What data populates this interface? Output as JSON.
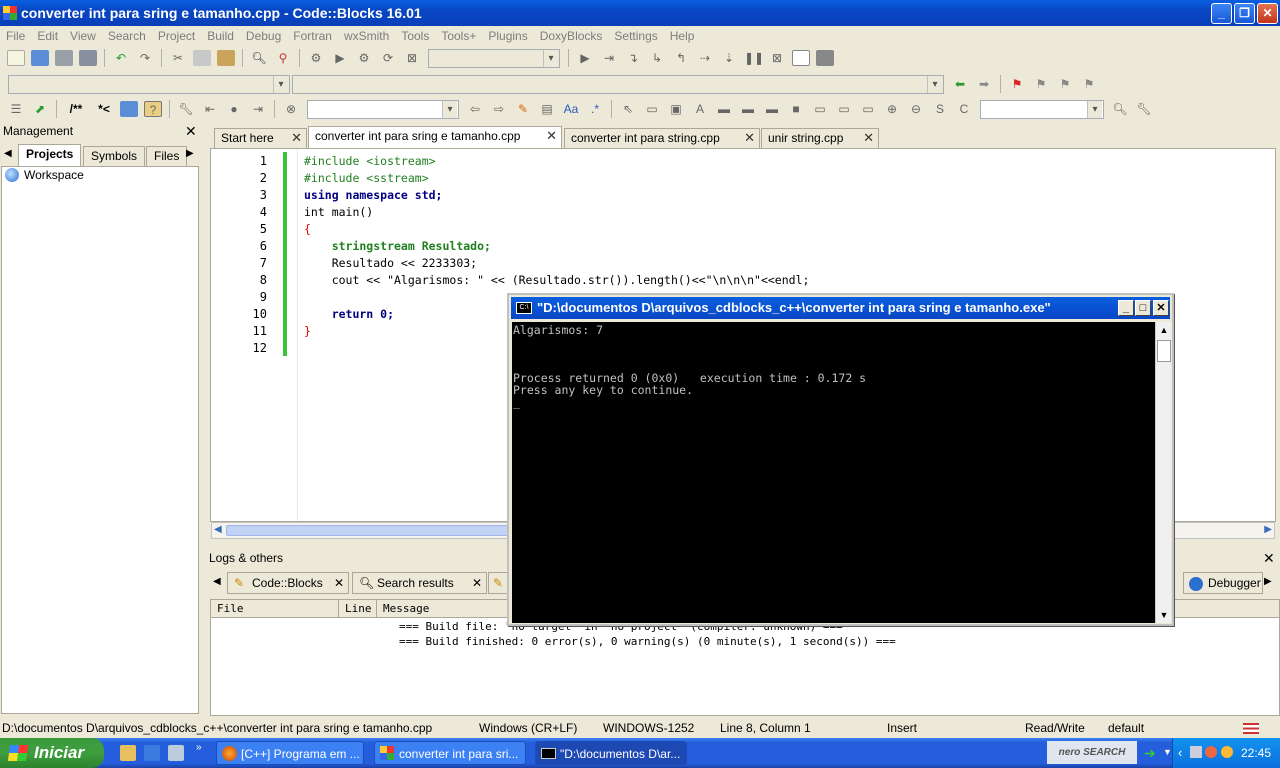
{
  "window": {
    "title": "converter int para sring e tamanho.cpp - Code::Blocks 16.01"
  },
  "menu": [
    "File",
    "Edit",
    "View",
    "Search",
    "Project",
    "Build",
    "Debug",
    "Fortran",
    "wxSmith",
    "Tools",
    "Tools+",
    "Plugins",
    "DoxyBlocks",
    "Settings",
    "Help"
  ],
  "management": {
    "title": "Management",
    "tabs": [
      "Projects",
      "Symbols",
      "Files"
    ],
    "tree_root": "Workspace"
  },
  "editor": {
    "tabs": [
      "Start here",
      "converter int para sring e tamanho.cpp",
      "converter int para string.cpp",
      "unir string.cpp"
    ],
    "active_tab": 1,
    "line_numbers": [
      "1",
      "2",
      "3",
      "4",
      "5",
      "6",
      "7",
      "8",
      "9",
      "10",
      "11",
      "12"
    ],
    "lines": [
      "#include <iostream>",
      "#include <sstream>",
      "using namespace std;",
      "int main()",
      "{",
      "    stringstream Resultado;",
      "    Resultado << 2233303;",
      "    cout << \"Algarismos: \" << (Resultado.str()).length()<<\"\\n\\n\\n\"<<endl;",
      "",
      "    return 0;",
      "}",
      ""
    ]
  },
  "logs": {
    "title": "Logs & others",
    "tabs": [
      "Code::Blocks",
      "Search results",
      "Debugger"
    ],
    "columns": [
      "File",
      "Line",
      "Message"
    ],
    "lines": [
      "=== Build file: \"no target\" in \"no project\" (compiler: unknown) ===",
      "=== Build finished: 0 error(s), 0 warning(s) (0 minute(s), 1 second(s)) ==="
    ]
  },
  "console": {
    "title": "\"D:\\documentos D\\arquivos_cdblocks_c++\\converter int para sring e tamanho.exe\"",
    "icon_text": "C:\\",
    "output": "Algarismos: 7\n\n\n\nProcess returned 0 (0x0)   execution time : 0.172 s\nPress any key to continue.\n_"
  },
  "status": {
    "path": "D:\\documentos D\\arquivos_cdblocks_c++\\converter int para sring e tamanho.cpp",
    "eol": "Windows (CR+LF)",
    "encoding": "WINDOWS-1252",
    "position": "Line 8, Column 1",
    "mode": "Insert",
    "access": "Read/Write",
    "profile": "default"
  },
  "taskbar": {
    "start": "Iniciar",
    "tasks": [
      "[C++] Programa em ...",
      "converter int para sri...",
      "\"D:\\documentos D\\ar..."
    ],
    "tray_logo": "nero SEARCH",
    "clock": "22:45"
  },
  "colors": {
    "title_blue": "#0846c4",
    "change_bar": "#3ac43a",
    "console_bg": "#000000",
    "start_green": "#3e9e3e"
  }
}
